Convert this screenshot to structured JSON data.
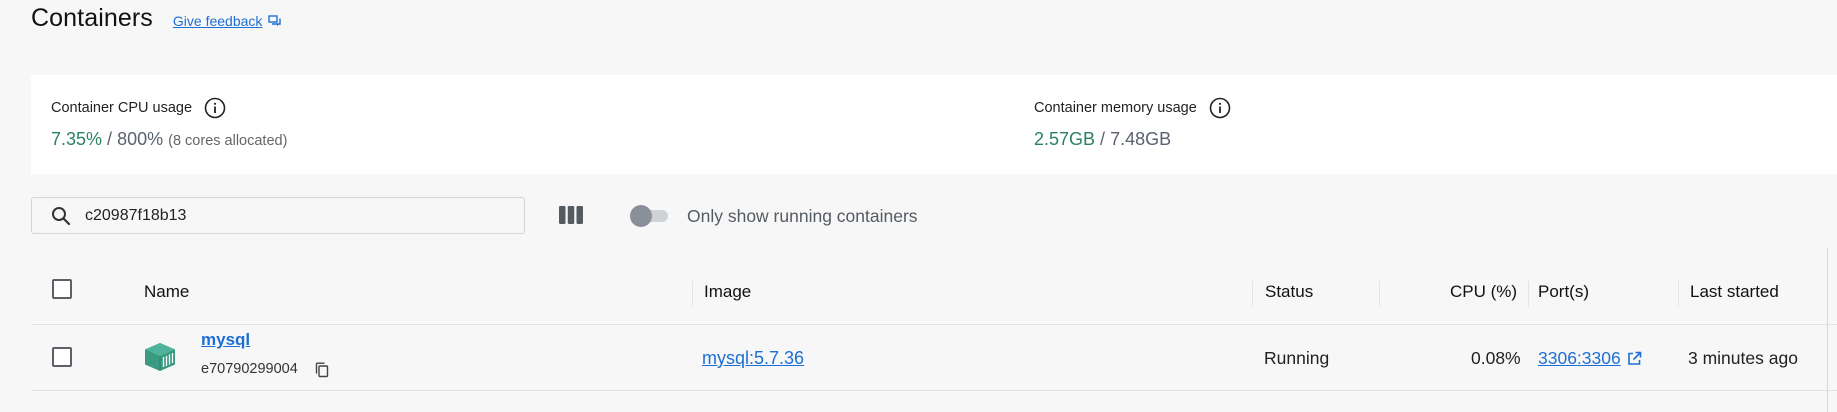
{
  "header": {
    "title": "Containers",
    "feedback_label": "Give feedback"
  },
  "stats": {
    "cpu": {
      "label": "Container CPU usage",
      "used": "7.35%",
      "separator": " / ",
      "total": "800%",
      "note": "(8 cores allocated)"
    },
    "memory": {
      "label": "Container memory usage",
      "used": "2.57GB",
      "separator": " / ",
      "total": "7.48GB"
    }
  },
  "toolbar": {
    "search_value": "c20987f18b13",
    "toggle_label": "Only show running containers",
    "toggle_on": false
  },
  "table": {
    "columns": [
      "Name",
      "Image",
      "Status",
      "CPU (%)",
      "Port(s)",
      "Last started"
    ],
    "rows": [
      {
        "name": "mysql",
        "id": "e70790299004",
        "image": "mysql:5.7.36",
        "status": "Running",
        "cpu": "0.08%",
        "ports": "3306:3306",
        "last_started": "3 minutes ago"
      }
    ]
  },
  "colors": {
    "accent_green": "#2b8263",
    "link_blue": "#1d6fd6",
    "container_icon": "#3a9b82"
  },
  "icons": {
    "feedback": "feedback-icon",
    "info": "info-icon",
    "search": "search-icon",
    "columns": "columns-icon",
    "container": "container-icon",
    "copy": "copy-icon",
    "external_link": "external-link-icon"
  }
}
